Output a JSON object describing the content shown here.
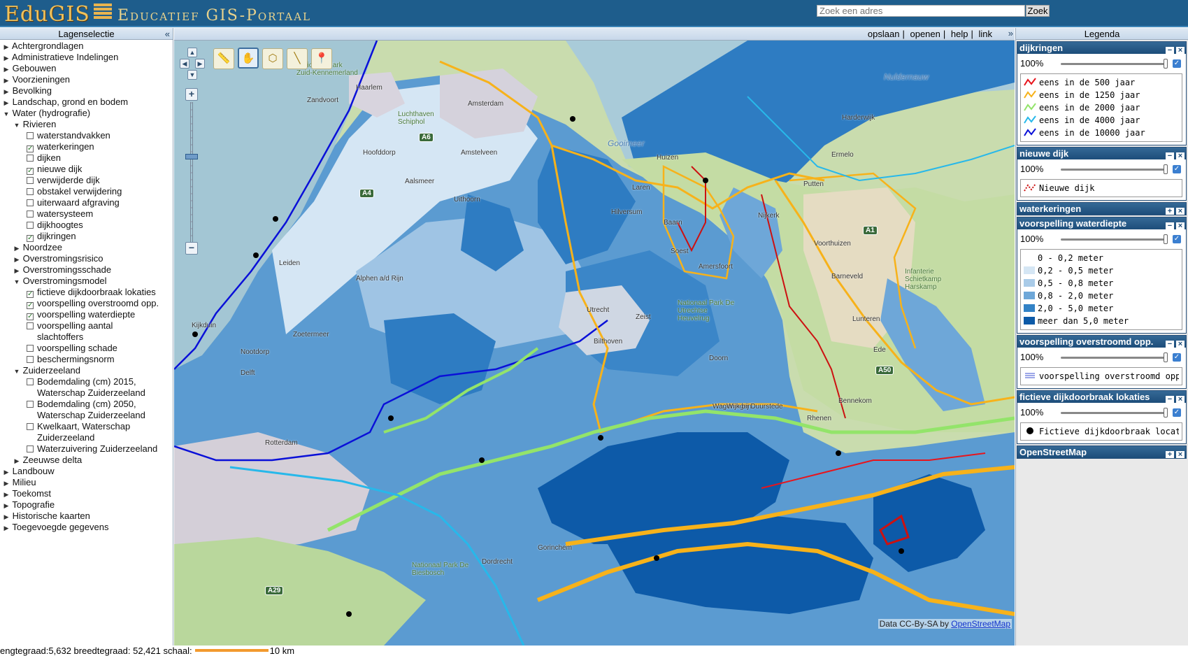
{
  "header": {
    "logo_text": "EduGIS",
    "portal_title": "Educatief GIS-Portaal",
    "search_placeholder": "Zoek een adres",
    "search_button": "Zoek"
  },
  "left_panel": {
    "title": "Lagenselectie",
    "collapse_glyph": "«",
    "tree": [
      {
        "label": "Achtergrondlagen",
        "level": 0,
        "type": "folder",
        "state": "collapsed"
      },
      {
        "label": "Administratieve Indelingen",
        "level": 0,
        "type": "folder",
        "state": "collapsed"
      },
      {
        "label": "Gebouwen",
        "level": 0,
        "type": "folder",
        "state": "collapsed"
      },
      {
        "label": "Voorzieningen",
        "level": 0,
        "type": "folder",
        "state": "collapsed"
      },
      {
        "label": "Bevolking",
        "level": 0,
        "type": "folder",
        "state": "collapsed"
      },
      {
        "label": "Landschap, grond en bodem",
        "level": 0,
        "type": "folder",
        "state": "collapsed"
      },
      {
        "label": "Water (hydrografie)",
        "level": 0,
        "type": "folder",
        "state": "expanded"
      },
      {
        "label": "Rivieren",
        "level": 1,
        "type": "folder",
        "state": "expanded"
      },
      {
        "label": "waterstandvakken",
        "level": 2,
        "type": "layer",
        "checked": false
      },
      {
        "label": "waterkeringen",
        "level": 2,
        "type": "layer",
        "checked": true
      },
      {
        "label": "dijken",
        "level": 2,
        "type": "layer",
        "checked": false
      },
      {
        "label": "nieuwe dijk",
        "level": 2,
        "type": "layer",
        "checked": true
      },
      {
        "label": "verwijderde dijk",
        "level": 2,
        "type": "layer",
        "checked": false
      },
      {
        "label": "obstakel verwijdering",
        "level": 2,
        "type": "layer",
        "checked": false
      },
      {
        "label": "uiterwaard afgraving",
        "level": 2,
        "type": "layer",
        "checked": false
      },
      {
        "label": "watersysteem",
        "level": 2,
        "type": "layer",
        "checked": false
      },
      {
        "label": "dijkhoogtes",
        "level": 2,
        "type": "layer",
        "checked": false
      },
      {
        "label": "dijkringen",
        "level": 2,
        "type": "layer",
        "checked": true
      },
      {
        "label": "Noordzee",
        "level": 1,
        "type": "folder",
        "state": "collapsed"
      },
      {
        "label": "Overstromingsrisico",
        "level": 1,
        "type": "folder",
        "state": "collapsed"
      },
      {
        "label": "Overstromingsschade",
        "level": 1,
        "type": "folder",
        "state": "collapsed"
      },
      {
        "label": "Overstromingsmodel",
        "level": 1,
        "type": "folder",
        "state": "expanded"
      },
      {
        "label": "fictieve dijkdoorbraak lokaties",
        "level": 2,
        "type": "layer",
        "checked": true
      },
      {
        "label": "voorspelling overstroomd opp.",
        "level": 2,
        "type": "layer",
        "checked": true
      },
      {
        "label": "voorspelling waterdiepte",
        "level": 2,
        "type": "layer",
        "checked": true
      },
      {
        "label": "voorspelling aantal",
        "level": 2,
        "type": "layer",
        "checked": false
      },
      {
        "label": "slachtoffers",
        "level": 2,
        "type": "cont"
      },
      {
        "label": "voorspelling schade",
        "level": 2,
        "type": "layer",
        "checked": false
      },
      {
        "label": "beschermingsnorm",
        "level": 2,
        "type": "layer",
        "checked": false
      },
      {
        "label": "Zuiderzeeland",
        "level": 1,
        "type": "folder",
        "state": "expanded"
      },
      {
        "label": "Bodemdaling (cm) 2015,",
        "level": 2,
        "type": "layer",
        "checked": false
      },
      {
        "label": "Waterschap Zuiderzeeland",
        "level": 2,
        "type": "cont"
      },
      {
        "label": "Bodemdaling (cm) 2050,",
        "level": 2,
        "type": "layer",
        "checked": false
      },
      {
        "label": "Waterschap Zuiderzeeland",
        "level": 2,
        "type": "cont"
      },
      {
        "label": "Kwelkaart, Waterschap",
        "level": 2,
        "type": "layer",
        "checked": false
      },
      {
        "label": "Zuiderzeeland",
        "level": 2,
        "type": "cont"
      },
      {
        "label": "Waterzuivering Zuiderzeeland",
        "level": 2,
        "type": "layer",
        "checked": false
      },
      {
        "label": "Zeeuwse delta",
        "level": 1,
        "type": "folder",
        "state": "collapsed"
      },
      {
        "label": "Landbouw",
        "level": 0,
        "type": "folder",
        "state": "collapsed"
      },
      {
        "label": "Milieu",
        "level": 0,
        "type": "folder",
        "state": "collapsed"
      },
      {
        "label": "Toekomst",
        "level": 0,
        "type": "folder",
        "state": "collapsed"
      },
      {
        "label": "Topografie",
        "level": 0,
        "type": "folder",
        "state": "collapsed"
      },
      {
        "label": "Historische kaarten",
        "level": 0,
        "type": "folder",
        "state": "collapsed"
      },
      {
        "label": "Toegevoegde gegevens",
        "level": 0,
        "type": "folder",
        "state": "collapsed"
      }
    ]
  },
  "map_toolbar": {
    "links": [
      "opslaan",
      "openen",
      "help",
      "link"
    ],
    "separator": "|",
    "expand_glyph": "»"
  },
  "map": {
    "tools": [
      {
        "name": "measure-tool",
        "icon": "ruler-icon",
        "glyph": "📏",
        "active": false
      },
      {
        "name": "pan-tool",
        "icon": "hand-icon",
        "glyph": "✋",
        "active": true
      },
      {
        "name": "polygon-tool",
        "icon": "polygon-icon",
        "glyph": "⬡",
        "active": false
      },
      {
        "name": "line-tool",
        "icon": "line-icon",
        "glyph": "╲",
        "active": false
      },
      {
        "name": "marker-tool",
        "icon": "pin-icon",
        "glyph": "📍",
        "active": false
      }
    ],
    "place_labels": [
      "Zandvoort",
      "Haarlem",
      "Amsterdam",
      "Hoofddorp",
      "Amstelveen",
      "Aalsmeer",
      "Uithoorn",
      "Leiden",
      "Alphen a/d Rijn",
      "Zoetermeer",
      "Delft",
      "Rotterdam",
      "Utrecht",
      "Bilthoven",
      "Zeist",
      "Huizen",
      "Laren",
      "Hilversum",
      "Baarn",
      "Soest",
      "Amersfoort",
      "Nijkerk",
      "Putten",
      "Ermelo",
      "Harderwijk",
      "Voorthuizen",
      "Barneveld",
      "Lunteren",
      "Ede",
      "Rhenen",
      "Wageningen",
      "Bennekom",
      "Doorn",
      "Wijk bij Duurstede",
      "Gooimeer",
      "Nootdorp",
      "Kijkduin",
      "Dordrecht",
      "Gorinchem",
      "Nationaal Park De Biesbosch",
      "Nationaal Park Zuid-Kennemerland",
      "Luchthaven Schiphol",
      "Nationaal Park De Utrechtse Heuvelrug",
      "Infanterie Schietkamp Harskamp",
      "Nuldernauw"
    ],
    "road_shields": [
      "A6",
      "A4",
      "A1",
      "A50",
      "A29"
    ],
    "attribution_prefix": "Data CC-By-SA by ",
    "attribution_link": "OpenStreetMap",
    "colors": {
      "water_very_deep": "#0d5aa8",
      "water_deep": "#2e7cc2",
      "water_mid": "#5b9bd1",
      "water_shallow": "#9fc4e4",
      "water_very_shallow": "#d5e6f4",
      "land": "#c9dcae",
      "dijkring_orange": "#f7b21a",
      "dijkring_green": "#93e46a",
      "dijkring_blue": "#0a10d8",
      "dijkring_cyan": "#27b8ea",
      "new_dike_red": "#cc1111"
    }
  },
  "legend_panel": {
    "title": "Legenda",
    "blocks": [
      {
        "title": "dijkringen",
        "expanded": true,
        "opacity": "100%",
        "items": [
          {
            "label": "eens in de 500 jaar",
            "color": "#e8141c",
            "kind": "line"
          },
          {
            "label": "eens in de 1250 jaar",
            "color": "#f7b21a",
            "kind": "line"
          },
          {
            "label": "eens in de 2000 jaar",
            "color": "#93e46a",
            "kind": "line"
          },
          {
            "label": "eens in de 4000 jaar",
            "color": "#27b8ea",
            "kind": "line"
          },
          {
            "label": "eens in de 10000 jaar",
            "color": "#0a10d8",
            "kind": "line"
          }
        ]
      },
      {
        "title": "nieuwe dijk",
        "expanded": true,
        "opacity": "100%",
        "items": [
          {
            "label": "Nieuwe dijk",
            "color": "#cc1111",
            "kind": "dashed"
          }
        ]
      },
      {
        "title": "waterkeringen",
        "expanded": false
      },
      {
        "title": "voorspelling waterdiepte",
        "expanded": true,
        "opacity": "100%",
        "items": [
          {
            "label": "0 - 0,2 meter",
            "color": "#ffffff",
            "kind": "box"
          },
          {
            "label": "0,2 - 0,5 meter",
            "color": "#d5e6f4",
            "kind": "box"
          },
          {
            "label": "0,5 - 0,8 meter",
            "color": "#a9cbe8",
            "kind": "box"
          },
          {
            "label": "0,8 - 2,0 meter",
            "color": "#6ea7d8",
            "kind": "box"
          },
          {
            "label": "2,0 - 5,0 meter",
            "color": "#3282c6",
            "kind": "box"
          },
          {
            "label": "meer dan 5,0 meter",
            "color": "#0d5aa8",
            "kind": "box"
          }
        ]
      },
      {
        "title": "voorspelling overstroomd opp.",
        "expanded": true,
        "opacity": "100%",
        "items": [
          {
            "label": "voorspelling overstroomd opp.",
            "color": "#3b4fd0",
            "kind": "lines"
          }
        ]
      },
      {
        "title": "fictieve dijkdoorbraak lokaties",
        "expanded": true,
        "opacity": "100%",
        "items": [
          {
            "label": "Fictieve dijkdoorbraak locaties",
            "color": "#000000",
            "kind": "dot"
          }
        ]
      },
      {
        "title": "OpenStreetMap",
        "expanded": false
      }
    ]
  },
  "statusbar": {
    "coords_text": "engtegraad:5,632 breedtegraad: 52,421 schaal:",
    "scale_text": "10 km"
  }
}
